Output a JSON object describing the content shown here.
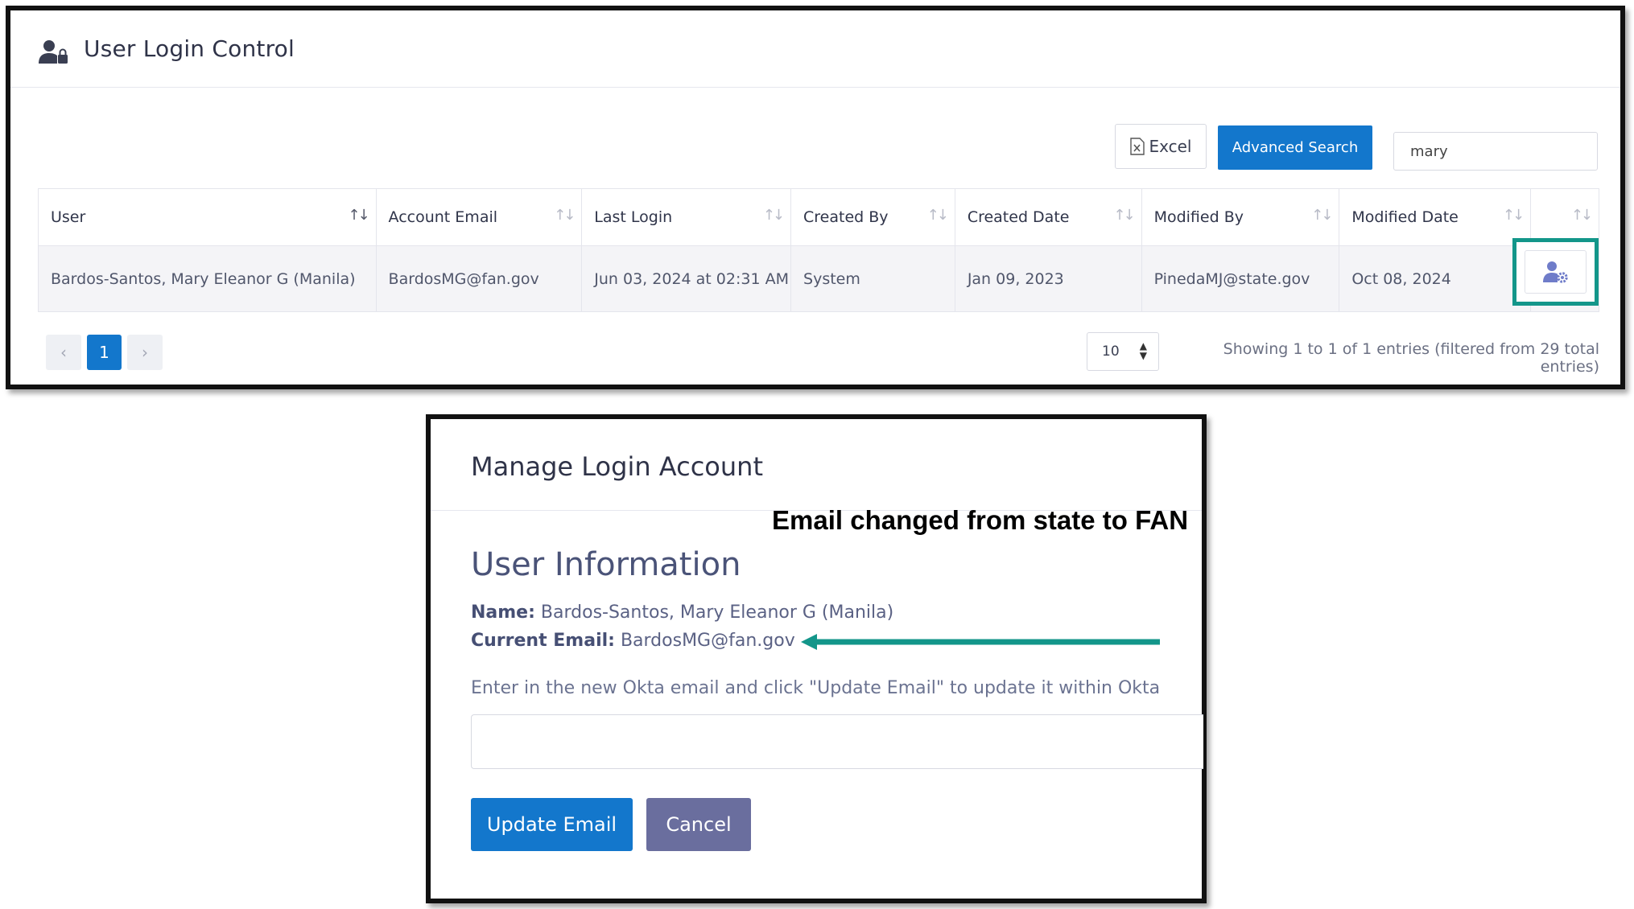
{
  "header": {
    "title": "User Login Control",
    "icon": "user-lock-icon"
  },
  "toolbar": {
    "excel_label": "Excel",
    "advanced_search_label": "Advanced Search",
    "search_value": "mary"
  },
  "table": {
    "columns": [
      "User",
      "Account Email",
      "Last Login",
      "Created By",
      "Created Date",
      "Modified By",
      "Modified Date",
      ""
    ],
    "rows": [
      {
        "user": "Bardos-Santos, Mary Eleanor G (Manila)",
        "account_email": "BardosMG@fan.gov",
        "last_login": "Jun 03, 2024 at 02:31 AM",
        "created_by": "System",
        "created_date": "Jan 09, 2023",
        "modified_by": "PinedaMJ@state.gov",
        "modified_date": "Oct 08, 2024",
        "action_icon": "user-gear-icon"
      }
    ]
  },
  "pagination": {
    "prev": "‹",
    "current_page": "1",
    "next": "›",
    "page_size": "10",
    "info": "Showing 1 to 1 of 1 entries (filtered from 29 total entries)"
  },
  "modal": {
    "title": "Manage Login Account",
    "annotation": "Email changed from state to FAN",
    "section_title": "User Information",
    "name_label": "Name:",
    "name_value": "Bardos-Santos, Mary Eleanor G (Manila)",
    "email_label": "Current Email:",
    "email_value": "BardosMG@fan.gov",
    "instructions": "Enter in the new Okta email and click \"Update Email\" to update it within Okta",
    "new_email_value": "",
    "update_label": "Update Email",
    "cancel_label": "Cancel"
  },
  "colors": {
    "primary": "#1377cc",
    "highlight": "#13968a",
    "cancel": "#6a6e9e"
  }
}
